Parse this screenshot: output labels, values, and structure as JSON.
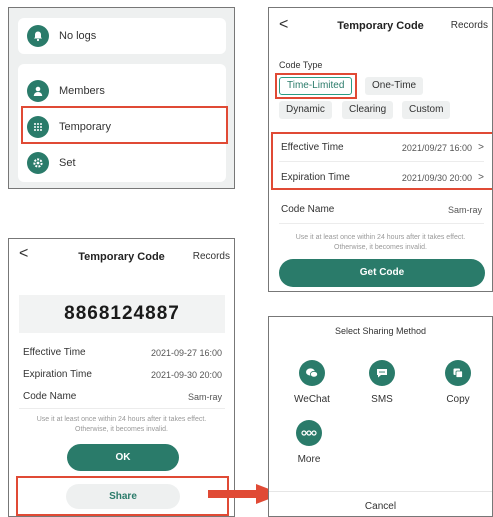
{
  "menu": {
    "items": [
      {
        "label": "No logs",
        "icon": "bell-icon"
      },
      {
        "label": "Members",
        "icon": "person-icon"
      },
      {
        "label": "Temporary",
        "icon": "grid-icon"
      },
      {
        "label": "Set",
        "icon": "gear-icon"
      }
    ]
  },
  "form": {
    "back": "<",
    "title": "Temporary Code",
    "records": "Records",
    "code_type_label": "Code Type",
    "types": [
      "Time-Limited",
      "One-Time",
      "Dynamic",
      "Clearing",
      "Custom"
    ],
    "effective_label": "Effective Time",
    "effective_value": "2021/09/27 16:00",
    "expiration_label": "Expiration Time",
    "expiration_value": "2021/09/30 20:00",
    "code_name_label": "Code Name",
    "code_name_value": "Sam-ray",
    "hint_line1": "Use it at least once within 24 hours after it takes effect.",
    "hint_line2": "Otherwise, it becomes invalid.",
    "get_code": "Get Code",
    "chevron": ">"
  },
  "result": {
    "back": "<",
    "title": "Temporary Code",
    "records": "Records",
    "code": "8868124887",
    "effective_label": "Effective Time",
    "effective_value": "2021-09-27 16:00",
    "expiration_label": "Expiration Time",
    "expiration_value": "2021-09-30 20:00",
    "code_name_label": "Code Name",
    "code_name_value": "Sam-ray",
    "hint_line1": "Use it at least once within 24 hours after it takes effect.",
    "hint_line2": "Otherwise, it becomes invalid.",
    "ok": "OK",
    "share": "Share"
  },
  "share_sheet": {
    "title": "Select Sharing Method",
    "options": [
      {
        "label": "WeChat",
        "icon": "wechat-icon"
      },
      {
        "label": "SMS",
        "icon": "sms-icon"
      },
      {
        "label": "Copy",
        "icon": "copy-icon"
      },
      {
        "label": "More",
        "icon": "more-icon"
      }
    ],
    "cancel": "Cancel"
  },
  "colors": {
    "brand_green": "#2a7b6a",
    "highlight_red": "#e04a35"
  }
}
